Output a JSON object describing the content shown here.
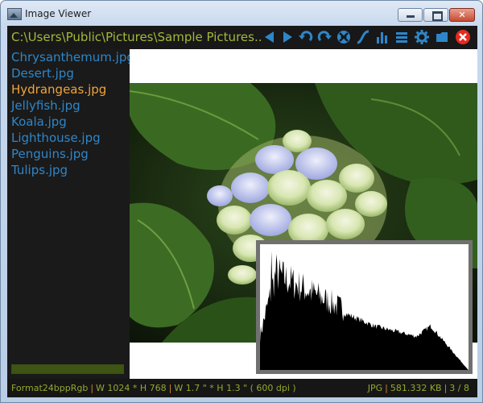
{
  "window": {
    "title": "Image Viewer"
  },
  "toolbar": {
    "path": "C:\\Users\\Public\\Pictures\\Sample Pictures...",
    "buttons": [
      {
        "icon": "previous-arrow-icon"
      },
      {
        "icon": "next-arrow-icon"
      },
      {
        "icon": "rotate-left-icon"
      },
      {
        "icon": "rotate-right-icon"
      },
      {
        "icon": "fit-to-window-icon"
      },
      {
        "icon": "curve-icon"
      },
      {
        "icon": "histogram-icon"
      },
      {
        "icon": "menu-icon"
      },
      {
        "icon": "gear-icon"
      },
      {
        "icon": "open-folder-icon"
      },
      {
        "icon": "close-icon"
      }
    ]
  },
  "files": [
    {
      "name": "Chrysanthemum.jpg",
      "selected": false
    },
    {
      "name": "Desert.jpg",
      "selected": false
    },
    {
      "name": "Hydrangeas.jpg",
      "selected": true
    },
    {
      "name": "Jellyfish.jpg",
      "selected": false
    },
    {
      "name": "Koala.jpg",
      "selected": false
    },
    {
      "name": "Lighthouse.jpg",
      "selected": false
    },
    {
      "name": "Penguins.jpg",
      "selected": false
    },
    {
      "name": "Tulips.jpg",
      "selected": false
    }
  ],
  "sidebar_progress": 1.0,
  "status": {
    "format": "Format24bppRgb",
    "dimensions": "W 1024 * H 768",
    "physical": "W 1.7 \" * H 1.3 \" ( 600 dpi )",
    "type": "JPG",
    "size": "581.332 KB",
    "index": "3 / 8"
  },
  "colors": {
    "path_text": "#a3b83c",
    "file_text": "#2e86c9",
    "selected_file": "#f0a43a",
    "toolbar_icon": "#2e86c9",
    "close_icon": "#e52b1e",
    "status_text": "#94a82f",
    "status_separator": "#d28b22"
  }
}
